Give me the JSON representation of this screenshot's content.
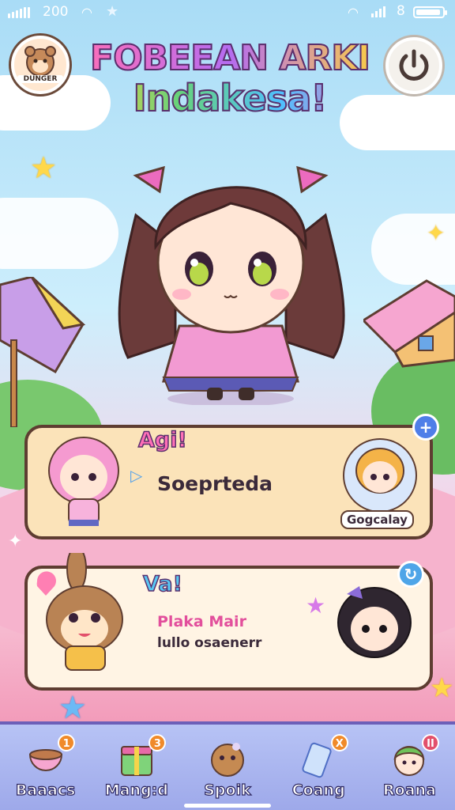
{
  "status_bar": {
    "time": "200",
    "extra": "8"
  },
  "header": {
    "avatar_label": "DUNGER",
    "title_line1": "FOBEEAN ARKI",
    "title_line2": "Indakesa!"
  },
  "cards": [
    {
      "tag": "Agi!",
      "text": "Soeprteda",
      "side_name": "Gogcalay",
      "button": "+"
    },
    {
      "tag": "Va!",
      "line1": "Plaka Mair",
      "line2": "lullo osaenerr",
      "button": "↻"
    }
  ],
  "nav": [
    {
      "label": "Baaacs",
      "badge": "1",
      "icon": "bowl-icon",
      "badge_color": "#f08a2a"
    },
    {
      "label": "Mang:d",
      "badge": "3",
      "icon": "gift-box-icon",
      "badge_color": "#f08a2a"
    },
    {
      "label": "Spoik",
      "badge": "",
      "icon": "cookie-icon",
      "badge_color": ""
    },
    {
      "label": "Coang",
      "badge": "X",
      "icon": "ticket-icon",
      "badge_color": "#f08a2a"
    },
    {
      "label": "Roana",
      "badge": "II",
      "icon": "character-face-icon",
      "badge_color": "#e2506b"
    }
  ],
  "colors": {
    "card_border": "#5e3d31",
    "nav_bg": "#a9b4ef",
    "accent_pink": "#ff6fb7",
    "accent_blue": "#4f7ee8"
  }
}
